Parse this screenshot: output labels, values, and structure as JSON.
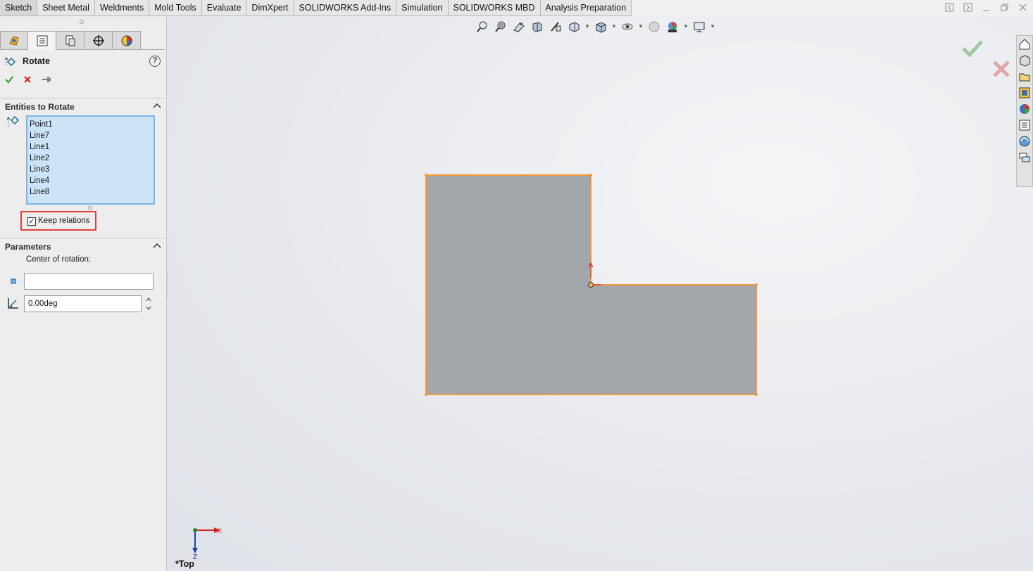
{
  "ribbon": {
    "tabs": [
      "Sketch",
      "Sheet Metal",
      "Weldments",
      "Mold Tools",
      "Evaluate",
      "DimXpert",
      "SOLIDWORKS Add-Ins",
      "Simulation",
      "SOLIDWORKS MBD",
      "Analysis Preparation"
    ],
    "active_tab": "Sketch"
  },
  "property_manager": {
    "title": "Rotate",
    "help": "?",
    "sections": {
      "entities": {
        "title": "Entities to Rotate",
        "items": [
          "Point1",
          "Line7",
          "Line1",
          "Line2",
          "Line3",
          "Line4",
          "Line8"
        ]
      },
      "keep_relations": {
        "label": "Keep relations",
        "checked": true
      },
      "parameters": {
        "title": "Parameters",
        "center_label": "Center of rotation:",
        "center_value": "",
        "angle_value": "0.00deg"
      }
    }
  },
  "viewport": {
    "view_name": "*Top",
    "axis_x": "X",
    "axis_z": "Z"
  },
  "colors": {
    "sketch_fill": "#a3a6ab",
    "sketch_edge": "#f2963a",
    "accent_select": "#7ab5e6",
    "highlight_box": "#e0403c"
  }
}
